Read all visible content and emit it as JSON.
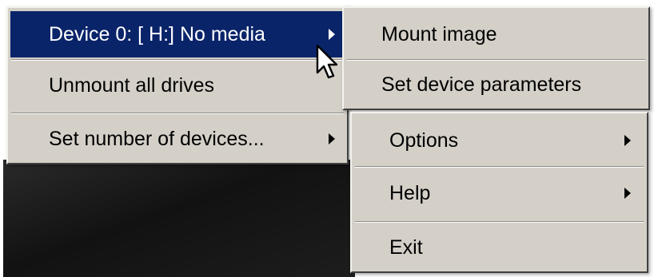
{
  "main_menu": {
    "items": [
      {
        "label": "Device 0: [ H:] No media",
        "has_submenu": true,
        "highlighted": true
      },
      {
        "label": "Unmount all drives",
        "has_submenu": false
      },
      {
        "label": "Set number of devices...",
        "has_submenu": true
      }
    ]
  },
  "device_submenu": {
    "items": [
      {
        "label": "Mount image"
      },
      {
        "label": "Set device parameters"
      }
    ]
  },
  "lower_menu": {
    "items": [
      {
        "label": "Options",
        "has_submenu": true
      },
      {
        "label": "Help",
        "has_submenu": true
      },
      {
        "label": "Exit",
        "has_submenu": false
      }
    ]
  },
  "icons": {
    "cursor": "mouse-pointer-icon",
    "submenu_arrow": "submenu-arrow-icon"
  },
  "colors": {
    "menu_background": "#d4d0c8",
    "highlight_background": "#0a246a",
    "highlight_text": "#ffffff",
    "text": "#000000"
  }
}
